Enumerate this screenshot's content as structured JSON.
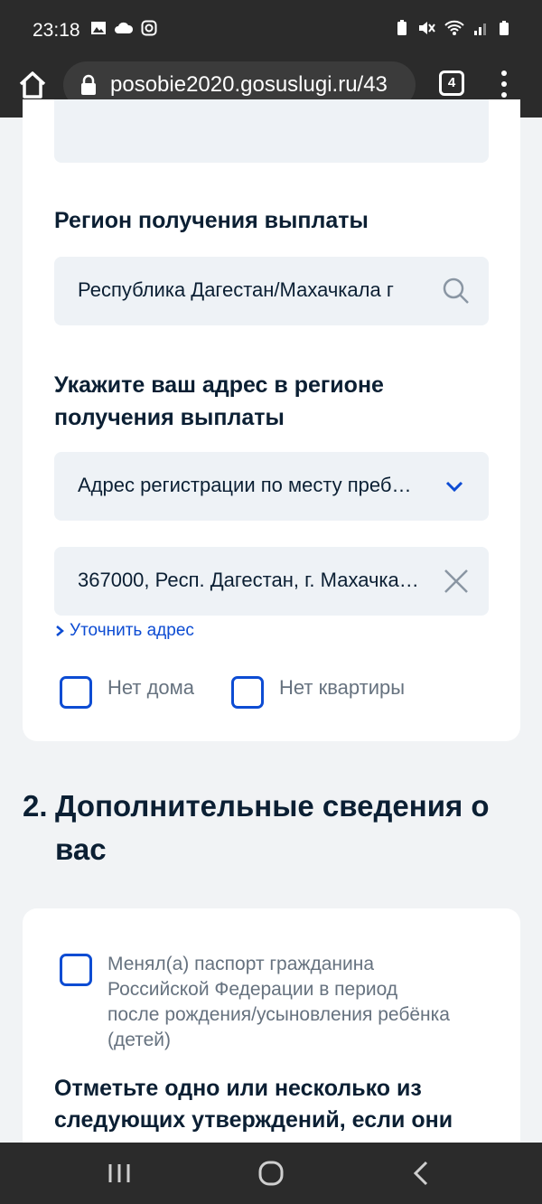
{
  "status_bar": {
    "time": "23:18"
  },
  "browser": {
    "url": "posobie2020.gosuslugi.ru/43",
    "tab_count": "4"
  },
  "form": {
    "region_label": "Регион получения выплаты",
    "region_value": "Республика Дагестан/Махачкала г",
    "address_label": "Укажите ваш адрес в регионе получения выплаты",
    "address_type_value": "Адрес регистрации по месту преб…",
    "address_value": "367000, Респ. Дагестан, г. Махачка…",
    "clarify_link": "Уточнить адрес",
    "no_house_label": "Нет дома",
    "no_apartment_label": "Нет квартиры"
  },
  "section2": {
    "number": "2.",
    "title": "Дополнительные сведения о вас",
    "passport_checkbox_label": "Менял(а) паспорт гражданина Российской Федерации в период после рождения/усыновления ребёнка (детей)",
    "statements_label": "Отметьте одно или несколько из следующих утверждений, если они"
  }
}
